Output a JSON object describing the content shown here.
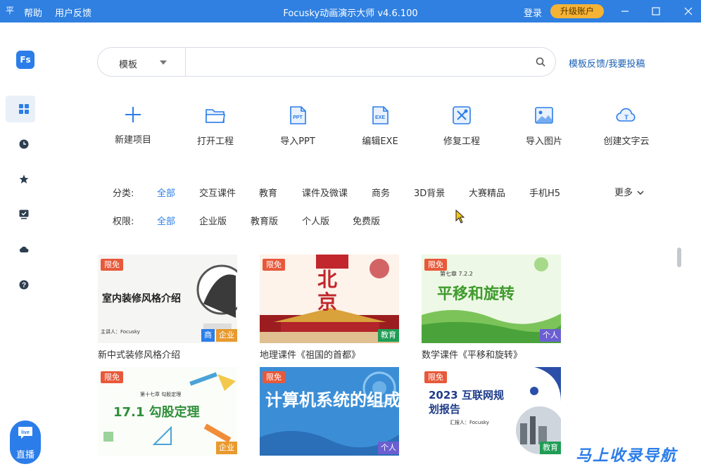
{
  "titlebar": {
    "logo_glyph": "平",
    "help": "帮助",
    "feedback": "用户反馈",
    "title": "Focusky动画演示大师 v4.6.100",
    "login": "登录",
    "upgrade": "升级账户"
  },
  "sidebar": {
    "logo": "Fs",
    "items": [
      "grid-icon",
      "clock-icon",
      "star-icon",
      "check-monitor-icon",
      "cloud-icon",
      "help-icon"
    ],
    "live_icon_text": "live",
    "live_label": "直播"
  },
  "search": {
    "category": "模板",
    "value": "",
    "placeholder": ""
  },
  "template_feedback": "模板反馈/我要投稿",
  "actions": [
    "新建项目",
    "打开工程",
    "导入PPT",
    "编辑EXE",
    "修复工程",
    "导入图片",
    "创建文字云"
  ],
  "filters": {
    "category_label": "分类:",
    "categories": [
      "全部",
      "交互课件",
      "教育",
      "课件及微课",
      "商务",
      "3D背景",
      "大赛精品",
      "手机H5"
    ],
    "selected_category": "全部",
    "more": "更多",
    "permission_label": "权限:",
    "permissions": [
      "全部",
      "企业版",
      "教育版",
      "个人版",
      "免费版"
    ],
    "selected_permission": "全部"
  },
  "cards": [
    {
      "name": "新中式装修风格介绍",
      "free": "限免",
      "tags": [
        "商",
        "企业"
      ],
      "thumb_title": "室内装修风格介绍",
      "thumb_sub": "主讲人：Focusky"
    },
    {
      "name": "地理课件《祖国的首都》",
      "free": "限免",
      "tags": [
        "教育"
      ],
      "thumb_title": "北京"
    },
    {
      "name": "数学课件《平移和旋转》",
      "free": "限免",
      "tags": [
        "个人"
      ],
      "thumb_title": "平移和旋转",
      "thumb_sub": "第七章 7.2.2"
    },
    {
      "name": "",
      "free": "限免",
      "tags": [
        "企业"
      ],
      "thumb_title": "17.1 勾股定理",
      "thumb_sub": "第十七章 勾股定理"
    },
    {
      "name": "",
      "free": "限免",
      "tags": [
        "个人"
      ],
      "thumb_title": "计算机系统的组成"
    },
    {
      "name": "",
      "free": "限免",
      "tags": [
        "教育"
      ],
      "thumb_title": "2023 互联网规划报告",
      "thumb_sub": "汇报人：Focusky"
    }
  ],
  "watermark": "马上收录导航",
  "colors": {
    "accent": "#2b7de9",
    "titlebar": "#2f80e1",
    "upgrade": "#f5b335",
    "free_badge": "#e8593a"
  }
}
